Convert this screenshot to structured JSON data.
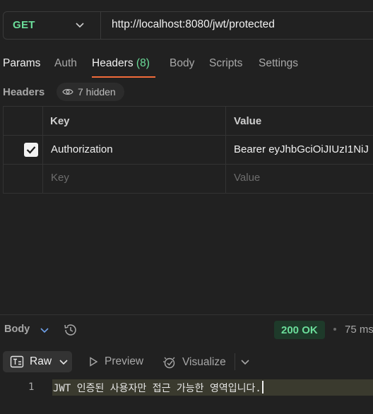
{
  "request": {
    "method": "GET",
    "url": "http://localhost:8080/jwt/protected"
  },
  "tabs": {
    "params": "Params",
    "auth": "Auth",
    "headers": "Headers",
    "headers_count": "(8)",
    "body": "Body",
    "scripts": "Scripts",
    "settings": "Settings"
  },
  "headers_section": {
    "title": "Headers",
    "hidden_label": "7 hidden",
    "columns": {
      "key": "Key",
      "value": "Value"
    },
    "rows": [
      {
        "checked": true,
        "key": "Authorization",
        "value": "Bearer eyJhbGciOiJIUzI1NiJ"
      }
    ],
    "new_row": {
      "key_placeholder": "Key",
      "value_placeholder": "Value"
    }
  },
  "response": {
    "title": "Body",
    "status": "200 OK",
    "time": "75 ms",
    "view_modes": {
      "raw": "Raw",
      "preview": "Preview",
      "visualize": "Visualize"
    },
    "lines": [
      {
        "number": "1",
        "text": "JWT 인증된 사용자만 접근 가능한 영역입니다."
      }
    ]
  },
  "colors": {
    "background": "#212121",
    "accent_green": "#6bdd9a",
    "tab_underline": "#f26b3a"
  }
}
